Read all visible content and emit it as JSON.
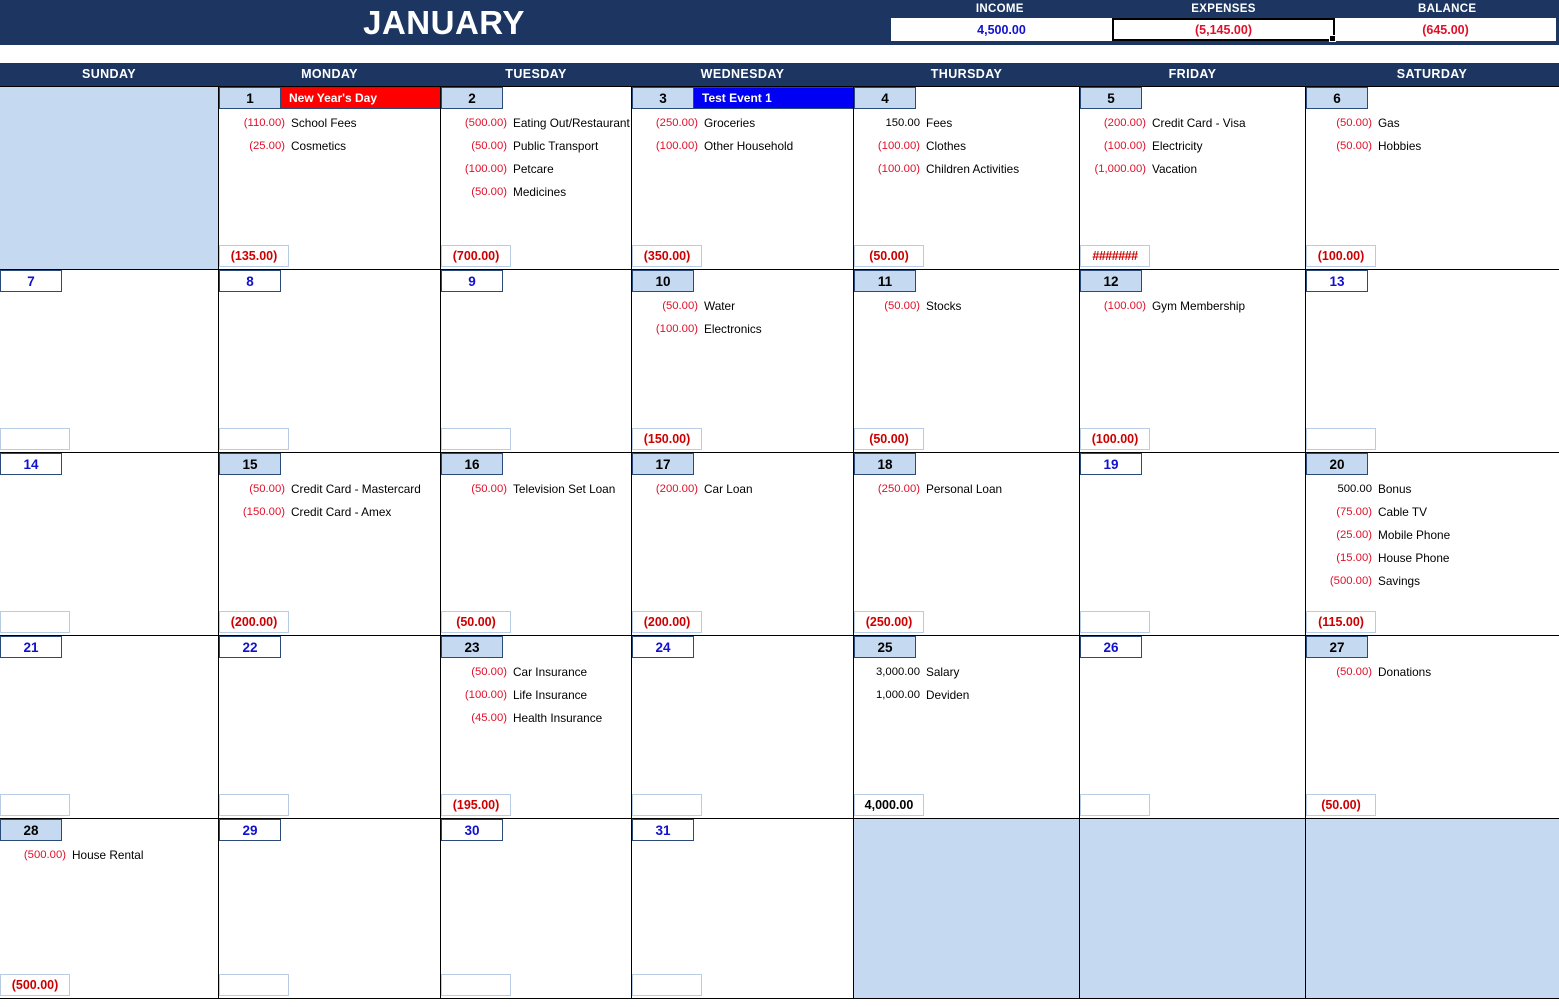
{
  "header": {
    "month_title": "JANUARY",
    "summary": [
      {
        "label": "INCOME",
        "value": "4,500.00",
        "sign": "pos",
        "selected": false
      },
      {
        "label": "EXPENSES",
        "value": "(5,145.00)",
        "sign": "neg",
        "selected": true
      },
      {
        "label": "BALANCE",
        "value": "(645.00)",
        "sign": "neg",
        "selected": false
      }
    ]
  },
  "weekdays": [
    "SUNDAY",
    "MONDAY",
    "TUESDAY",
    "WEDNESDAY",
    "THURSDAY",
    "FRIDAY",
    "SATURDAY"
  ],
  "weeks": [
    {
      "days": [
        {
          "num": "",
          "blank": true
        },
        {
          "num": "1",
          "active": true,
          "banner": {
            "text": "New Year's Day",
            "color": "red"
          },
          "entries": [
            {
              "amount": "(110.00)",
              "sign": "neg",
              "desc": "School Fees"
            },
            {
              "amount": "(25.00)",
              "sign": "neg",
              "desc": "Cosmetics"
            }
          ],
          "total": "(135.00)",
          "total_sign": "neg"
        },
        {
          "num": "2",
          "active": true,
          "entries": [
            {
              "amount": "(500.00)",
              "sign": "neg",
              "desc": "Eating Out/Restaurant"
            },
            {
              "amount": "(50.00)",
              "sign": "neg",
              "desc": "Public Transport"
            },
            {
              "amount": "(100.00)",
              "sign": "neg",
              "desc": "Petcare"
            },
            {
              "amount": "(50.00)",
              "sign": "neg",
              "desc": "Medicines"
            }
          ],
          "total": "(700.00)",
          "total_sign": "neg"
        },
        {
          "num": "3",
          "active": true,
          "banner": {
            "text": "Test Event 1",
            "color": "blue"
          },
          "entries": [
            {
              "amount": "(250.00)",
              "sign": "neg",
              "desc": "Groceries"
            },
            {
              "amount": "(100.00)",
              "sign": "neg",
              "desc": "Other Household"
            }
          ],
          "total": "(350.00)",
          "total_sign": "neg"
        },
        {
          "num": "4",
          "active": true,
          "entries": [
            {
              "amount": "150.00",
              "sign": "pos",
              "desc": "Fees"
            },
            {
              "amount": "(100.00)",
              "sign": "neg",
              "desc": "Clothes"
            },
            {
              "amount": "(100.00)",
              "sign": "neg",
              "desc": "Children Activities"
            }
          ],
          "total": "(50.00)",
          "total_sign": "neg"
        },
        {
          "num": "5",
          "active": true,
          "entries": [
            {
              "amount": "(200.00)",
              "sign": "neg",
              "desc": "Credit Card - Visa"
            },
            {
              "amount": "(100.00)",
              "sign": "neg",
              "desc": "Electricity"
            },
            {
              "amount": "(1,000.00)",
              "sign": "neg",
              "desc": "Vacation"
            }
          ],
          "total": "#######",
          "total_sign": "over"
        },
        {
          "num": "6",
          "active": true,
          "entries": [
            {
              "amount": "(50.00)",
              "sign": "neg",
              "desc": "Gas"
            },
            {
              "amount": "(50.00)",
              "sign": "neg",
              "desc": "Hobbies"
            }
          ],
          "total": "(100.00)",
          "total_sign": "neg"
        }
      ]
    },
    {
      "days": [
        {
          "num": "7",
          "active": false,
          "entries": [],
          "total": "",
          "total_sign": "empty"
        },
        {
          "num": "8",
          "active": false,
          "entries": [],
          "total": "",
          "total_sign": "empty"
        },
        {
          "num": "9",
          "active": false,
          "entries": [],
          "total": "",
          "total_sign": "empty"
        },
        {
          "num": "10",
          "active": true,
          "entries": [
            {
              "amount": "(50.00)",
              "sign": "neg",
              "desc": "Water"
            },
            {
              "amount": "(100.00)",
              "sign": "neg",
              "desc": "Electronics"
            }
          ],
          "total": "(150.00)",
          "total_sign": "neg"
        },
        {
          "num": "11",
          "active": true,
          "entries": [
            {
              "amount": "(50.00)",
              "sign": "neg",
              "desc": "Stocks"
            }
          ],
          "total": "(50.00)",
          "total_sign": "neg"
        },
        {
          "num": "12",
          "active": true,
          "entries": [
            {
              "amount": "(100.00)",
              "sign": "neg",
              "desc": "Gym Membership"
            }
          ],
          "total": "(100.00)",
          "total_sign": "neg"
        },
        {
          "num": "13",
          "active": false,
          "entries": [],
          "total": "",
          "total_sign": "empty"
        }
      ]
    },
    {
      "days": [
        {
          "num": "14",
          "active": false,
          "entries": [],
          "total": "",
          "total_sign": "empty"
        },
        {
          "num": "15",
          "active": true,
          "entries": [
            {
              "amount": "(50.00)",
              "sign": "neg",
              "desc": "Credit Card - Mastercard"
            },
            {
              "amount": "(150.00)",
              "sign": "neg",
              "desc": "Credit Card - Amex"
            }
          ],
          "total": "(200.00)",
          "total_sign": "neg"
        },
        {
          "num": "16",
          "active": true,
          "entries": [
            {
              "amount": "(50.00)",
              "sign": "neg",
              "desc": "Television Set Loan"
            }
          ],
          "total": "(50.00)",
          "total_sign": "neg"
        },
        {
          "num": "17",
          "active": true,
          "entries": [
            {
              "amount": "(200.00)",
              "sign": "neg",
              "desc": "Car Loan"
            }
          ],
          "total": "(200.00)",
          "total_sign": "neg"
        },
        {
          "num": "18",
          "active": true,
          "entries": [
            {
              "amount": "(250.00)",
              "sign": "neg",
              "desc": "Personal Loan"
            }
          ],
          "total": "(250.00)",
          "total_sign": "neg"
        },
        {
          "num": "19",
          "active": false,
          "entries": [],
          "total": "",
          "total_sign": "empty"
        },
        {
          "num": "20",
          "active": true,
          "entries": [
            {
              "amount": "500.00",
              "sign": "pos",
              "desc": "Bonus"
            },
            {
              "amount": "(75.00)",
              "sign": "neg",
              "desc": "Cable TV"
            },
            {
              "amount": "(25.00)",
              "sign": "neg",
              "desc": "Mobile Phone"
            },
            {
              "amount": "(15.00)",
              "sign": "neg",
              "desc": "House Phone"
            },
            {
              "amount": "(500.00)",
              "sign": "neg",
              "desc": "Savings"
            }
          ],
          "total": "(115.00)",
          "total_sign": "neg"
        }
      ]
    },
    {
      "days": [
        {
          "num": "21",
          "active": false,
          "entries": [],
          "total": "",
          "total_sign": "empty"
        },
        {
          "num": "22",
          "active": false,
          "entries": [],
          "total": "",
          "total_sign": "empty"
        },
        {
          "num": "23",
          "active": true,
          "entries": [
            {
              "amount": "(50.00)",
              "sign": "neg",
              "desc": "Car Insurance"
            },
            {
              "amount": "(100.00)",
              "sign": "neg",
              "desc": "Life Insurance"
            },
            {
              "amount": "(45.00)",
              "sign": "neg",
              "desc": "Health Insurance"
            }
          ],
          "total": "(195.00)",
          "total_sign": "neg"
        },
        {
          "num": "24",
          "active": false,
          "entries": [],
          "total": "",
          "total_sign": "empty"
        },
        {
          "num": "25",
          "active": true,
          "entries": [
            {
              "amount": "3,000.00",
              "sign": "pos",
              "desc": "Salary"
            },
            {
              "amount": "1,000.00",
              "sign": "pos",
              "desc": "Deviden"
            }
          ],
          "total": "4,000.00",
          "total_sign": "pos"
        },
        {
          "num": "26",
          "active": false,
          "entries": [],
          "total": "",
          "total_sign": "empty"
        },
        {
          "num": "27",
          "active": true,
          "entries": [
            {
              "amount": "(50.00)",
              "sign": "neg",
              "desc": "Donations"
            }
          ],
          "total": "(50.00)",
          "total_sign": "neg"
        }
      ]
    },
    {
      "days": [
        {
          "num": "28",
          "active": true,
          "entries": [
            {
              "amount": "(500.00)",
              "sign": "neg",
              "desc": "House Rental"
            }
          ],
          "total": "(500.00)",
          "total_sign": "neg"
        },
        {
          "num": "29",
          "active": false,
          "entries": [],
          "total": "",
          "total_sign": "empty"
        },
        {
          "num": "30",
          "active": false,
          "entries": [],
          "total": "",
          "total_sign": "empty"
        },
        {
          "num": "31",
          "active": false,
          "entries": [],
          "total": "",
          "total_sign": "empty"
        },
        {
          "num": "",
          "blank": true
        },
        {
          "num": "",
          "blank": true
        },
        {
          "num": "",
          "blank": true
        }
      ]
    }
  ],
  "colors": {
    "header_navy": "#1c3661",
    "cell_blue": "#c5d9f1",
    "expense_red": "#e0102a",
    "event_red": "#fe0000",
    "event_blue": "#0000f5",
    "day_number_blue": "#1010cf"
  }
}
